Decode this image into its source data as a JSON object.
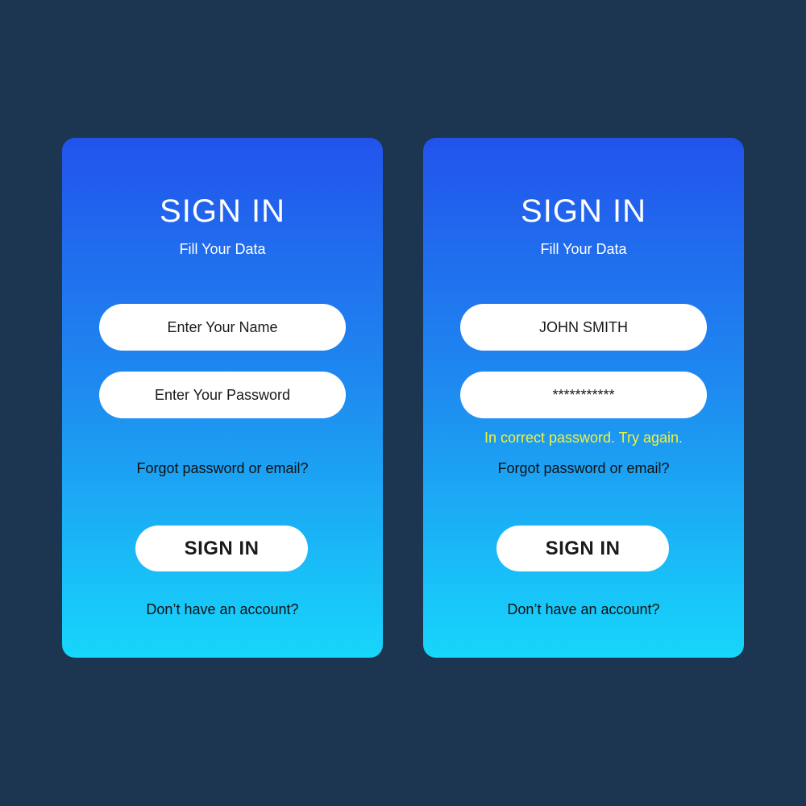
{
  "colors": {
    "background": "#1c3551",
    "card_gradient_top": "#2253ec",
    "card_gradient_bottom": "#17d6fb",
    "error_text": "#f2f23a",
    "field_background": "#ffffff"
  },
  "cards": [
    {
      "title": "SIGN IN",
      "subtitle": "Fill Your Data",
      "name_field": {
        "value": "",
        "placeholder": "Enter Your Name"
      },
      "password_field": {
        "value": "",
        "placeholder": "Enter Your Password"
      },
      "forgot_link": "Forgot password or email?",
      "sign_in_button": "SIGN IN",
      "no_account_link": "Don’t have an account?"
    },
    {
      "title": "SIGN IN",
      "subtitle": "Fill Your Data",
      "name_field": {
        "value": "JOHN SMITH"
      },
      "password_field": {
        "value": "***********"
      },
      "error_message": "In correct password. Try again.",
      "forgot_link": "Forgot password or email?",
      "sign_in_button": "SIGN IN",
      "no_account_link": "Don’t have an account?"
    }
  ]
}
